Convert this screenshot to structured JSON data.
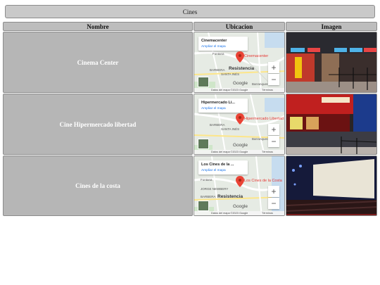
{
  "table": {
    "title": "Cines",
    "headers": {
      "name": "Nombre",
      "location": "Ubicacion",
      "image": "Imagen"
    },
    "rows": [
      {
        "name": "Cinema Center",
        "map": {
          "card_title": "Cinemacenter",
          "card_link": "Ampliar el mapa",
          "pin_label": "Cinemacenter",
          "city": "Resistencia",
          "places": [
            "Fontana",
            "BARBERA",
            "SANTA INÉS",
            "Barranqueras"
          ],
          "google": "Google",
          "footer": [
            "Datos del mapa ©2023 Google",
            "Términos"
          ]
        },
        "image": "cinema-lobby"
      },
      {
        "name": "Cine Hipermercado libertad",
        "map": {
          "card_title": "Hipermercado Li...",
          "card_link": "Ampliar el mapa",
          "pin_label": "Hipermercado Libertad",
          "city": "",
          "places": [
            "BARBERA",
            "SANTA INÉS",
            "Barranqueras"
          ],
          "google": "Google",
          "footer": [
            "Datos del mapa ©2023 Google",
            "Términos"
          ]
        },
        "image": "concession-counter"
      },
      {
        "name": "Cines de la costa",
        "map": {
          "card_title": "Los Cines de la ...",
          "card_link": "Ampliar el mapa",
          "pin_label": "Los Cines de la Costa",
          "city": "Resistencia",
          "places": [
            "Fontana",
            "JORGE NEWBERY",
            "BARBERA"
          ],
          "google": "Google",
          "footer": [
            "Datos del mapa ©2023 Google",
            "Términos"
          ]
        },
        "image": "theater-screen"
      }
    ]
  },
  "map_controls": {
    "zoom_in": "+",
    "zoom_out": "−"
  }
}
